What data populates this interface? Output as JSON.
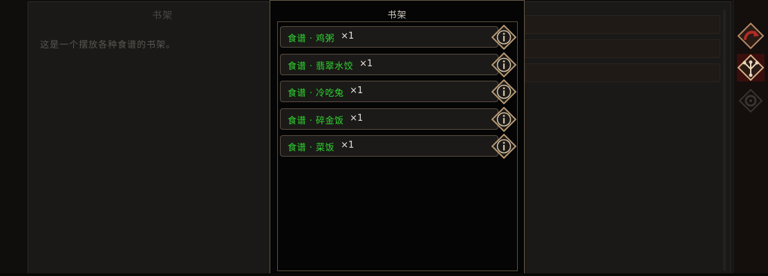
{
  "background_panel": {
    "title": "书架",
    "description": "这是一个摆放各种食谱的书架。"
  },
  "modal": {
    "title": "书架",
    "items": [
      {
        "name": "食谱 · 鸡粥",
        "qty": "×1"
      },
      {
        "name": "食谱 · 翡翠水饺",
        "qty": "×1"
      },
      {
        "name": "食谱 · 冷吃兔",
        "qty": "×1"
      },
      {
        "name": "食谱 · 碎金饭",
        "qty": "×1"
      },
      {
        "name": "食谱 · 菜饭",
        "qty": "×1"
      }
    ]
  },
  "colors": {
    "item_name": "#2fd62f",
    "border_gold": "#6a5a48",
    "accent_red": "#a8322a"
  },
  "icons": {
    "info": "info-icon",
    "sidebar": [
      "return-arrow-icon",
      "tree-branch-icon",
      "gear-icon"
    ]
  }
}
